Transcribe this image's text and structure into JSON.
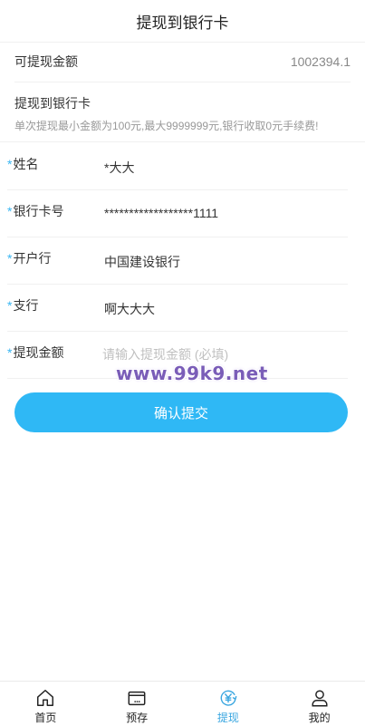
{
  "header": {
    "title": "提现到银行卡"
  },
  "balance": {
    "label": "可提现金额",
    "value": "1002394.1"
  },
  "section": {
    "title": "提现到银行卡",
    "note": "单次提现最小金额为100元,最大9999999元,银行收取0元手续费!"
  },
  "form": {
    "required_mark": "*",
    "name": {
      "label": "姓名",
      "value": "*大大"
    },
    "card_no": {
      "label": "银行卡号",
      "value": "******************1111"
    },
    "bank": {
      "label": "开户行",
      "value": "中国建设银行"
    },
    "branch": {
      "label": "支行",
      "value": "啊大大大"
    },
    "amount": {
      "label": "提现金额",
      "value": "",
      "placeholder": "请输入提现金额 (必填)"
    }
  },
  "watermark": "www.99k9.net",
  "submit_label": "确认提交",
  "tabbar": {
    "active": "withdraw",
    "items": [
      {
        "label": "首页",
        "icon": "home-icon"
      },
      {
        "label": "预存",
        "icon": "wallet-icon"
      },
      {
        "label": "提现",
        "icon": "yuan-exchange-icon"
      },
      {
        "label": "我的",
        "icon": "user-icon"
      }
    ]
  },
  "colors": {
    "accent": "#2fb8f5",
    "tab_active": "#39a6e0",
    "watermark": "#7a5db8"
  }
}
